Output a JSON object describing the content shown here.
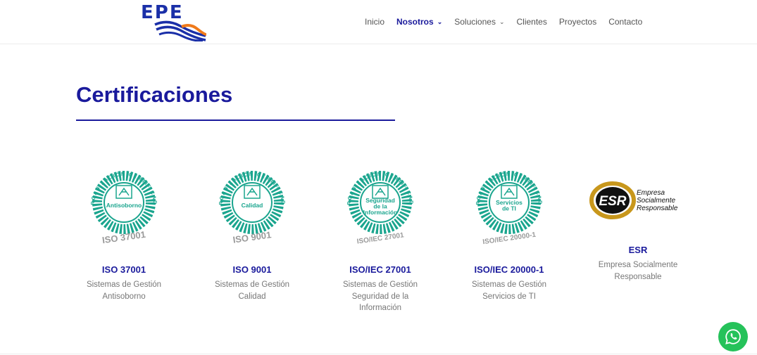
{
  "header": {
    "logo_text": "EPE",
    "nav": [
      {
        "label": "Inicio",
        "active": false,
        "dropdown": false
      },
      {
        "label": "Nosotros",
        "active": true,
        "dropdown": true
      },
      {
        "label": "Soluciones",
        "active": false,
        "dropdown": true
      },
      {
        "label": "Clientes",
        "active": false,
        "dropdown": false
      },
      {
        "label": "Proyectos",
        "active": false,
        "dropdown": false
      },
      {
        "label": "Contacto",
        "active": false,
        "dropdown": false
      }
    ]
  },
  "page": {
    "title": "Certificaciones"
  },
  "badge_ring_text": "ORGANIZACIÓN CERTIFICADA",
  "certs": [
    {
      "center": [
        "Antisoborno"
      ],
      "standard": "ISO 37001",
      "name": "ISO 37001",
      "desc": [
        "Sistemas de Gestión",
        "Antisoborno"
      ]
    },
    {
      "center": [
        "Calidad"
      ],
      "standard": "ISO 9001",
      "name": "ISO 9001",
      "desc": [
        "Sistemas de Gestión",
        "Calidad"
      ]
    },
    {
      "center": [
        "Seguridad",
        "de la",
        "Información"
      ],
      "standard": "ISO/IEC 27001",
      "name": "ISO/IEC 27001",
      "desc": [
        "Sistemas de Gestión",
        "Seguridad de la",
        "Información"
      ]
    },
    {
      "center": [
        "Servicios",
        "de TI"
      ],
      "standard": "ISO/IEC 20000-1",
      "name": "ISO/IEC 20000-1",
      "desc": [
        "Sistemas de Gestión",
        "Servicios de TI"
      ]
    }
  ],
  "esr": {
    "mark": "ESR",
    "logo_lines": [
      "Empresa",
      "Socialmente",
      "Responsable"
    ],
    "name": "ESR",
    "desc": [
      "Empresa Socialmente",
      "Responsable"
    ]
  },
  "colors": {
    "brand_blue": "#1a1a9c",
    "badge_teal": "#1aa58e",
    "badge_gray": "#9a9a9a",
    "esr_gold": "#c8971c",
    "whatsapp_green": "#25c25a"
  },
  "icons": {
    "whatsapp": "whatsapp-icon",
    "chevron": "chevron-down-icon"
  }
}
